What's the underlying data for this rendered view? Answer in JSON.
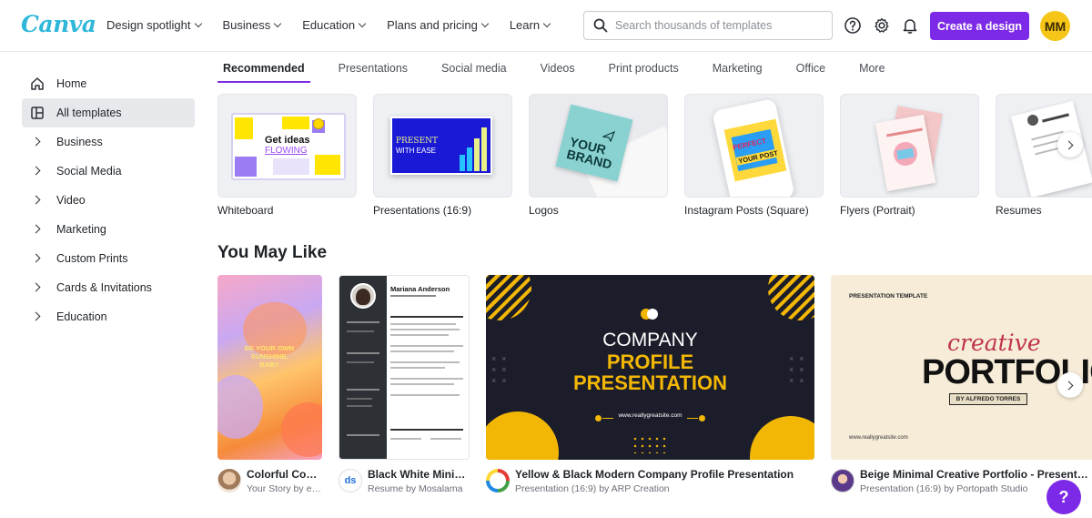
{
  "header": {
    "logo": "Canva",
    "nav": [
      {
        "label": "Design spotlight"
      },
      {
        "label": "Business"
      },
      {
        "label": "Education"
      },
      {
        "label": "Plans and pricing"
      },
      {
        "label": "Learn"
      }
    ],
    "search_placeholder": "Search thousands of templates",
    "create_label": "Create a design",
    "avatar_initials": "MM",
    "accent": "#7d2ae8"
  },
  "sidebar": {
    "items": [
      {
        "label": "Home",
        "icon": "home-icon"
      },
      {
        "label": "All templates",
        "icon": "templates-icon",
        "active": true
      },
      {
        "label": "Business"
      },
      {
        "label": "Social Media"
      },
      {
        "label": "Video"
      },
      {
        "label": "Marketing"
      },
      {
        "label": "Custom Prints"
      },
      {
        "label": "Cards & Invitations"
      },
      {
        "label": "Education"
      }
    ]
  },
  "tabs": [
    "Recommended",
    "Presentations",
    "Social media",
    "Videos",
    "Print products",
    "Marketing",
    "Office",
    "More"
  ],
  "categories": [
    {
      "label": "Whiteboard",
      "thumb_text": "Get ideas",
      "thumb_text2": "FLOWING"
    },
    {
      "label": "Presentations (16:9)",
      "thumb_text": "PRESENT",
      "thumb_text2": "WITH EASE"
    },
    {
      "label": "Logos",
      "thumb_text": "YOUR",
      "thumb_text2": "BRAND"
    },
    {
      "label": "Instagram Posts (Square)",
      "thumb_text": "PERFECT",
      "thumb_text2": "YOUR POST"
    },
    {
      "label": "Flyers (Portrait)"
    },
    {
      "label": "Resumes"
    }
  ],
  "section_title": "You May Like",
  "templates": [
    {
      "title": "Colorful Cool...",
      "subtitle": "Your Story by ec...",
      "thumb_text": "BE YOUR OWN SUNSHINE, BABY"
    },
    {
      "title": "Black White Minim...",
      "subtitle": "Resume by Mosalama",
      "thumb_text": "Mariana Anderson"
    },
    {
      "title": "Yellow & Black Modern Company Profile Presentation",
      "subtitle": "Presentation (16:9) by ARP Creation",
      "thumb_text": "COMPANY",
      "thumb_text2": "PROFILE",
      "thumb_text3": "PRESENTATION",
      "thumb_text4": "www.reallygreatsite.com"
    },
    {
      "title": "Beige Minimal Creative Portfolio - Presentation",
      "subtitle": "Presentation (16:9) by Portopath Studio",
      "thumb_text": "PRESENTATION TEMPLATE",
      "thumb_text2": "creative",
      "thumb_text3": "PORTFOLIO",
      "thumb_text4": "BY ALFREDO TORRES",
      "thumb_text5": "www.reallygreatsite.com"
    }
  ],
  "help_label": "?"
}
